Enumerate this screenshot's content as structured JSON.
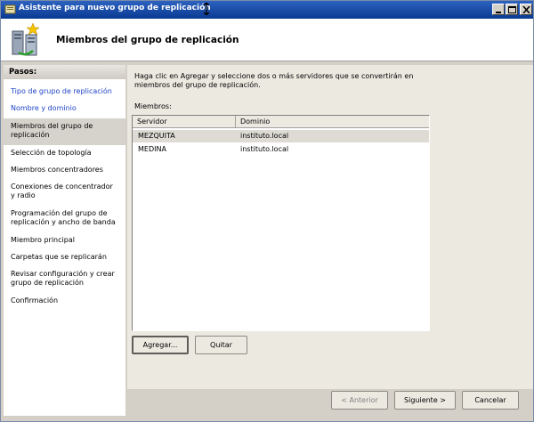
{
  "window": {
    "title": "Asistente para nuevo grupo de replicación"
  },
  "header": {
    "title": "Miembros del grupo de replicación"
  },
  "steps": {
    "title": "Pasos:",
    "items": [
      {
        "label": "Tipo de grupo de replicación"
      },
      {
        "label": "Nombre y dominio"
      },
      {
        "label": "Miembros del grupo de replicación"
      },
      {
        "label": "Selección de topología"
      },
      {
        "label": "Miembros concentradores"
      },
      {
        "label": "Conexiones de concentrador y radio"
      },
      {
        "label": "Programación del grupo de replicación y ancho de banda"
      },
      {
        "label": "Miembro principal"
      },
      {
        "label": "Carpetas que se replicarán"
      },
      {
        "label": "Revisar configuración y crear grupo de replicación"
      },
      {
        "label": "Confirmación"
      }
    ]
  },
  "main": {
    "intro": "Haga clic en Agregar y seleccione dos o más servidores que se convertirán en miembros del grupo de replicación.",
    "members_label": "Miembros:",
    "columns": [
      "Servidor",
      "Dominio"
    ],
    "rows": [
      {
        "server": "MEZQUITA",
        "domain": "instituto.local"
      },
      {
        "server": "MEDINA",
        "domain": "instituto.local"
      }
    ],
    "add_label": "Agregar...",
    "remove_label": "Quitar"
  },
  "footer": {
    "back_label": "< Anterior",
    "next_label": "Siguiente >",
    "cancel_label": "Cancelar"
  },
  "colors": {
    "titlebar": "#0a3a92",
    "link": "#1f45c4"
  }
}
